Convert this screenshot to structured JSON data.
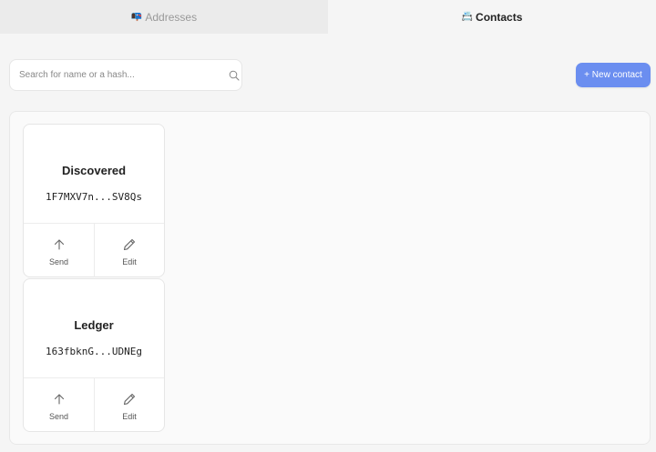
{
  "tabs": [
    {
      "emoji": "📭",
      "label": "Addresses",
      "active": false
    },
    {
      "emoji": "📇",
      "label": "Contacts",
      "active": true
    }
  ],
  "search": {
    "placeholder": "Search for name or a hash...",
    "value": "",
    "icon": "search-icon"
  },
  "new_contact_label": "+ New contact",
  "colors": {
    "accent": "#6b8ef0",
    "tab_inactive_bg": "#ebebeb"
  },
  "contacts": [
    {
      "name": "Discovered",
      "hash": "1F7MXV7n...SV8Qs",
      "send_label": "Send",
      "edit_label": "Edit"
    },
    {
      "name": "Ledger",
      "hash": "163fbknG...UDNEg",
      "send_label": "Send",
      "edit_label": "Edit"
    }
  ]
}
